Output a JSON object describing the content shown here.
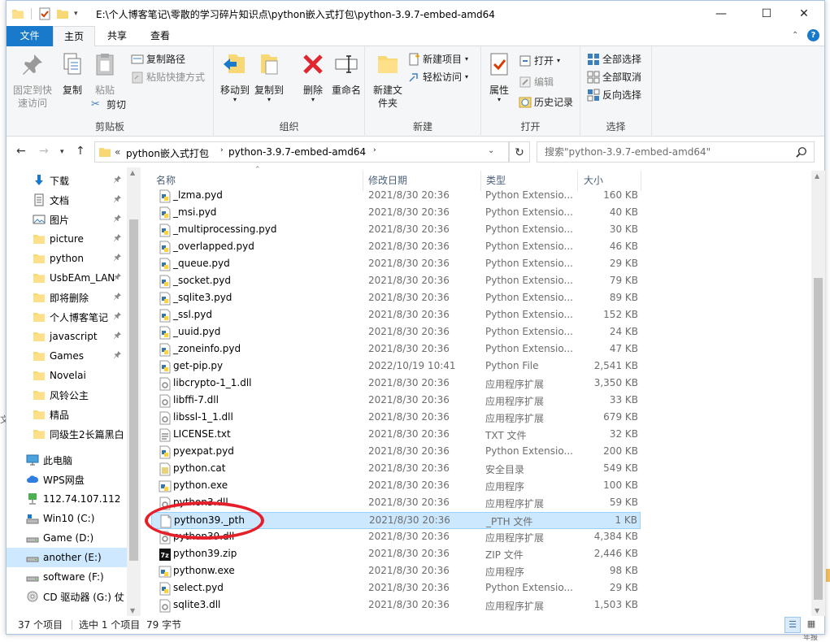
{
  "window": {
    "path": "E:\\个人博客笔记\\零散的学习碎片知识点\\python嵌入式打包\\python-3.9.7-embed-amd64",
    "minimize": "—",
    "maximize": "☐",
    "close": "✕"
  },
  "tabs": [
    {
      "label": "文件"
    },
    {
      "label": "主页"
    },
    {
      "label": "共享"
    },
    {
      "label": "查看"
    }
  ],
  "ribbon": {
    "clipboard": {
      "label": "剪贴板",
      "pin": "固定到快速访问",
      "copy": "复制",
      "paste": "粘贴",
      "copy_path": "复制路径",
      "paste_shortcut": "粘贴快捷方式",
      "cut": "剪切"
    },
    "organize": {
      "label": "组织",
      "move_to": "移动到",
      "copy_to": "复制到",
      "delete": "删除",
      "rename": "重命名"
    },
    "new": {
      "label": "新建",
      "new_folder": "新建文件夹",
      "new_item": "新建项目",
      "easy_access": "轻松访问"
    },
    "open": {
      "label": "打开",
      "properties": "属性",
      "open": "打开",
      "edit": "编辑",
      "history": "历史记录"
    },
    "select": {
      "label": "选择",
      "select_all": "全部选择",
      "select_none": "全部取消",
      "invert": "反向选择"
    }
  },
  "address": {
    "prefix": "«",
    "crumb1": "python嵌入式打包",
    "crumb2": "python-3.9.7-embed-amd64",
    "search_placeholder": "搜索\"python-3.9.7-embed-amd64\""
  },
  "sidebar": {
    "items": [
      {
        "label": "下载",
        "icon": "download-arrow-icon",
        "pinned": true
      },
      {
        "label": "文档",
        "icon": "document-icon",
        "pinned": true
      },
      {
        "label": "图片",
        "icon": "picture-icon",
        "pinned": true
      },
      {
        "label": "picture",
        "icon": "folder-icon",
        "pinned": true
      },
      {
        "label": "python",
        "icon": "folder-icon",
        "pinned": true
      },
      {
        "label": "UsbEAm_LAN",
        "icon": "folder-icon",
        "pinned": true
      },
      {
        "label": "即将删除",
        "icon": "folder-icon",
        "pinned": true
      },
      {
        "label": "个人博客笔记",
        "icon": "folder-icon",
        "pinned": true
      },
      {
        "label": "javascript",
        "icon": "folder-icon",
        "pinned": true
      },
      {
        "label": "Games",
        "icon": "folder-icon",
        "pinned": true
      },
      {
        "label": "Novelai",
        "icon": "folder-icon",
        "pinned": false
      },
      {
        "label": "风铃公主",
        "icon": "folder-icon",
        "pinned": false
      },
      {
        "label": "精品",
        "icon": "folder-icon",
        "pinned": false
      },
      {
        "label": "同级生2长篇黑白",
        "icon": "folder-icon",
        "pinned": false
      },
      {
        "label": "此电脑",
        "icon": "pc-icon",
        "pinned": false
      },
      {
        "label": "WPS网盘",
        "icon": "cloud-icon",
        "pinned": false
      },
      {
        "label": "112.74.107.112",
        "icon": "network-drive-icon",
        "pinned": false
      },
      {
        "label": "Win10 (C:)",
        "icon": "system-drive-icon",
        "pinned": false
      },
      {
        "label": "Game (D:)",
        "icon": "drive-icon",
        "pinned": false
      },
      {
        "label": "another (E:)",
        "icon": "drive-icon",
        "pinned": false
      },
      {
        "label": "software (F:)",
        "icon": "drive-icon",
        "pinned": false
      },
      {
        "label": "CD 驱动器 (G:) 仗",
        "icon": "cd-drive-icon",
        "pinned": false
      }
    ],
    "pin_glyph": "📌"
  },
  "columns": {
    "name": "名称",
    "date": "修改日期",
    "type": "类型",
    "size": "大小"
  },
  "files": [
    {
      "name": "_lzma.pyd",
      "date": "2021/8/30 20:36",
      "type": "Python Extensio...",
      "size": "160 KB",
      "icon": "pyd"
    },
    {
      "name": "_msi.pyd",
      "date": "2021/8/30 20:36",
      "type": "Python Extensio...",
      "size": "40 KB",
      "icon": "pyd"
    },
    {
      "name": "_multiprocessing.pyd",
      "date": "2021/8/30 20:36",
      "type": "Python Extensio...",
      "size": "30 KB",
      "icon": "pyd"
    },
    {
      "name": "_overlapped.pyd",
      "date": "2021/8/30 20:36",
      "type": "Python Extensio...",
      "size": "46 KB",
      "icon": "pyd"
    },
    {
      "name": "_queue.pyd",
      "date": "2021/8/30 20:36",
      "type": "Python Extensio...",
      "size": "29 KB",
      "icon": "pyd"
    },
    {
      "name": "_socket.pyd",
      "date": "2021/8/30 20:36",
      "type": "Python Extensio...",
      "size": "79 KB",
      "icon": "pyd"
    },
    {
      "name": "_sqlite3.pyd",
      "date": "2021/8/30 20:36",
      "type": "Python Extensio...",
      "size": "89 KB",
      "icon": "pyd"
    },
    {
      "name": "_ssl.pyd",
      "date": "2021/8/30 20:36",
      "type": "Python Extensio...",
      "size": "152 KB",
      "icon": "pyd"
    },
    {
      "name": "_uuid.pyd",
      "date": "2021/8/30 20:36",
      "type": "Python Extensio...",
      "size": "24 KB",
      "icon": "pyd"
    },
    {
      "name": "_zoneinfo.pyd",
      "date": "2021/8/30 20:36",
      "type": "Python Extensio...",
      "size": "47 KB",
      "icon": "pyd"
    },
    {
      "name": "get-pip.py",
      "date": "2022/10/19 10:41",
      "type": "Python File",
      "size": "2,541 KB",
      "icon": "py"
    },
    {
      "name": "libcrypto-1_1.dll",
      "date": "2021/8/30 20:36",
      "type": "应用程序扩展",
      "size": "3,350 KB",
      "icon": "dll"
    },
    {
      "name": "libffi-7.dll",
      "date": "2021/8/30 20:36",
      "type": "应用程序扩展",
      "size": "33 KB",
      "icon": "dll"
    },
    {
      "name": "libssl-1_1.dll",
      "date": "2021/8/30 20:36",
      "type": "应用程序扩展",
      "size": "679 KB",
      "icon": "dll"
    },
    {
      "name": "LICENSE.txt",
      "date": "2021/8/30 20:36",
      "type": "TXT 文件",
      "size": "32 KB",
      "icon": "txt"
    },
    {
      "name": "pyexpat.pyd",
      "date": "2021/8/30 20:36",
      "type": "Python Extensio...",
      "size": "200 KB",
      "icon": "pyd"
    },
    {
      "name": "python.cat",
      "date": "2021/8/30 20:36",
      "type": "安全目录",
      "size": "549 KB",
      "icon": "cat"
    },
    {
      "name": "python.exe",
      "date": "2021/8/30 20:36",
      "type": "应用程序",
      "size": "100 KB",
      "icon": "exe"
    },
    {
      "name": "python3.dll",
      "date": "2021/8/30 20:36",
      "type": "应用程序扩展",
      "size": "59 KB",
      "icon": "dll"
    },
    {
      "name": "python39._pth",
      "date": "2021/8/30 20:36",
      "type": "_PTH 文件",
      "size": "1 KB",
      "icon": "blank",
      "selected": true
    },
    {
      "name": "python39.dll",
      "date": "2021/8/30 20:36",
      "type": "应用程序扩展",
      "size": "4,384 KB",
      "icon": "dll"
    },
    {
      "name": "python39.zip",
      "date": "2021/8/30 20:36",
      "type": "ZIP 文件",
      "size": "2,446 KB",
      "icon": "zip"
    },
    {
      "name": "pythonw.exe",
      "date": "2021/8/30 20:36",
      "type": "应用程序",
      "size": "98 KB",
      "icon": "exe"
    },
    {
      "name": "select.pyd",
      "date": "2021/8/30 20:36",
      "type": "Python Extensio...",
      "size": "29 KB",
      "icon": "pyd"
    },
    {
      "name": "sqlite3.dll",
      "date": "2021/8/30 20:36",
      "type": "应用程序扩展",
      "size": "1,503 KB",
      "icon": "dll"
    }
  ],
  "status": {
    "count": "37 个项目",
    "selected": "选中 1 个项目",
    "size": "79 字节"
  },
  "background": {
    "left_frag": "文",
    "bottom_right_frag": "年报"
  },
  "colors": {
    "accent": "#1979ca",
    "selection": "#cce8ff",
    "annotation": "#e5202a"
  }
}
